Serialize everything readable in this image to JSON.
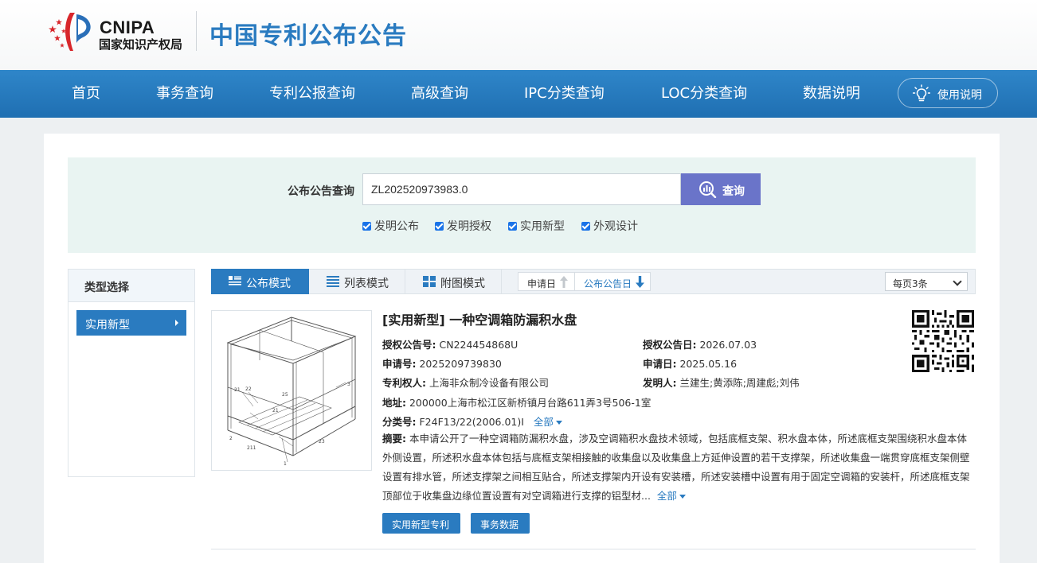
{
  "header": {
    "logo_en": "CNIPA",
    "logo_cn": "国家知识产权局",
    "site_title": "中国专利公布公告"
  },
  "nav": {
    "items": [
      "首页",
      "事务查询",
      "专利公报查询",
      "高级查询",
      "IPC分类查询",
      "LOC分类查询",
      "数据说明"
    ],
    "help_label": "使用说明"
  },
  "search": {
    "label": "公布公告查询",
    "value": "ZL202520973983.0",
    "button_label": "查询",
    "checkboxes": [
      {
        "label": "发明公布",
        "checked": true
      },
      {
        "label": "发明授权",
        "checked": true
      },
      {
        "label": "实用新型",
        "checked": true
      },
      {
        "label": "外观设计",
        "checked": true
      }
    ]
  },
  "sidebar": {
    "title": "类型选择",
    "items": [
      "实用新型"
    ]
  },
  "toolbar": {
    "modes": [
      "公布模式",
      "列表模式",
      "附图模式"
    ],
    "active_mode": "公布模式",
    "sort": [
      "申请日",
      "公布公告日"
    ],
    "per_page": "每页3条"
  },
  "record": {
    "title": "[实用新型] 一种空调箱防漏积水盘",
    "grant_no_label": "授权公告号:",
    "grant_no": "CN224454868U",
    "grant_date_label": "授权公告日:",
    "grant_date": "2026.07.03",
    "app_no_label": "申请号:",
    "app_no": "2025209739830",
    "app_date_label": "申请日:",
    "app_date": "2025.05.16",
    "patentee_label": "专利权人:",
    "patentee": "上海非众制冷设备有限公司",
    "inventor_label": "发明人:",
    "inventor": "兰建生;黄添陈;周建彪;刘伟",
    "address_label": "地址:",
    "address": "200000上海市松江区新桥镇月台路611弄3号506-1室",
    "class_label": "分类号:",
    "class_no": "F24F13/22(2006.01)I",
    "more_label": "全部",
    "abstract_label": "摘要:",
    "abstract": "本申请公开了一种空调箱防漏积水盘，涉及空调箱积水盘技术领域，包括底框支架、积水盘本体，所述底框支架围绕积水盘本体外侧设置，所述积水盘本体包括与底框支架相接触的收集盘以及收集盘上方延伸设置的若干支撑架，所述收集盘一端贯穿底框支架侧壁设置有排水管，所述支撑架之间相互贴合，所述支撑架内开设有安装槽，所述安装槽中设置有用于固定空调箱的安装杆，所述底框支架顶部位于收集盘边缘位置设置有对空调箱进行支撑的铝型材...",
    "buttons": [
      "实用新型专利",
      "事务数据"
    ],
    "figure_labels": [
      "3",
      "21",
      "22",
      "25",
      "21",
      "2",
      "211",
      "23",
      "1"
    ]
  },
  "colors": {
    "nav_blue": "#2a7bc0",
    "search_button": "#6a74c9",
    "search_panel": "#e9f4f2"
  }
}
